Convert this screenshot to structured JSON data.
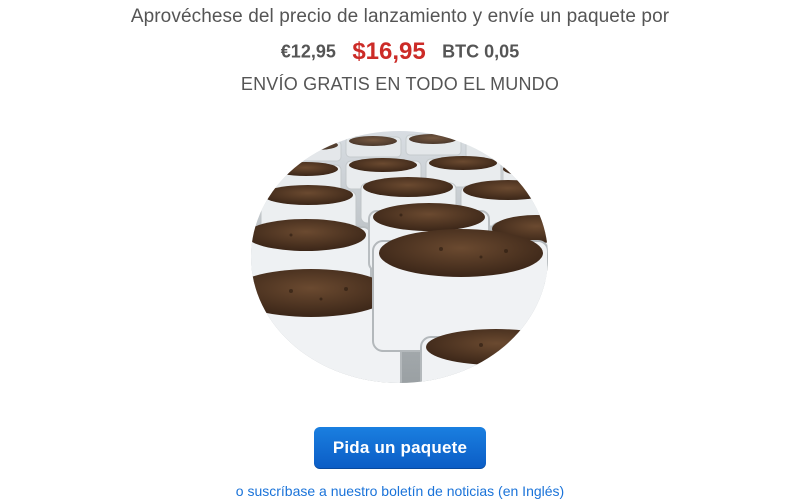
{
  "offer": {
    "intro_text": "Aprovéchese del precio de lanzamiento y envíe un paquete por",
    "price_eur": "€12,95",
    "price_usd": "$16,95",
    "price_btc": "BTC 0,05",
    "shipping_text": "ENVÍO GRATIS EN TODO EL MUNDO"
  },
  "cta": {
    "button_label": "Pida un paquete",
    "newsletter_link": "o suscríbase a nuestro boletín de noticias (en Inglés)"
  },
  "colors": {
    "price_highlight": "#cc2b27",
    "button": "#1a7fe0",
    "link": "#1a73d9",
    "body_text": "#555555"
  }
}
